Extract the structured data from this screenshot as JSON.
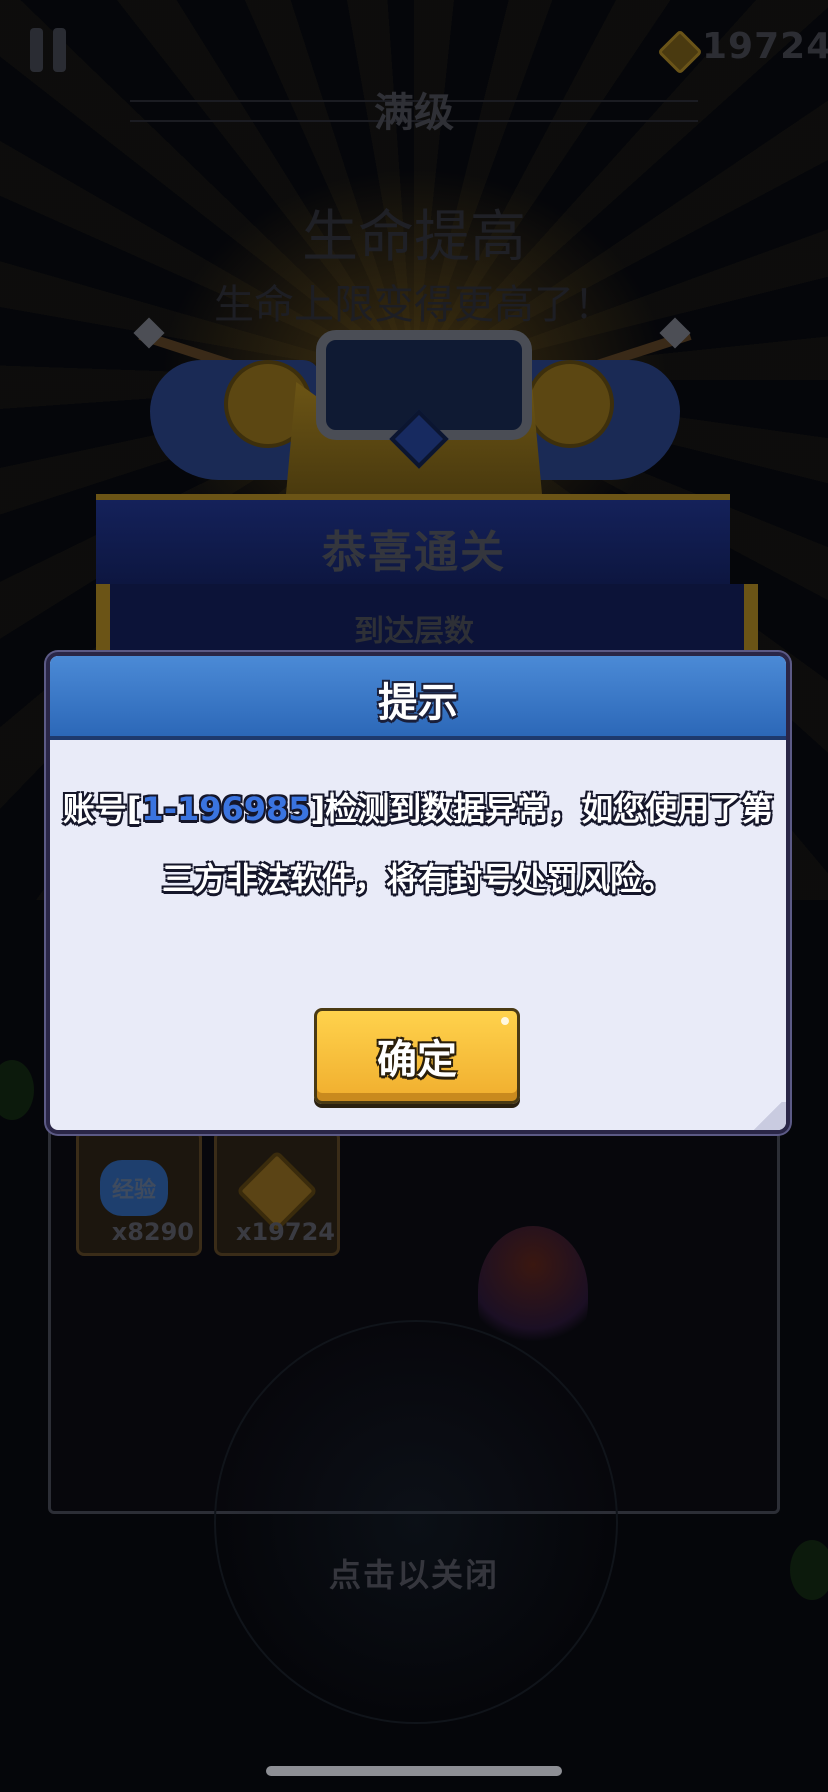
{
  "hud": {
    "gold_count": "19724",
    "pause_icon": "pause-icon",
    "gem_icon": "diamond-gem-icon"
  },
  "background": {
    "max_level": "满级",
    "bonus_title": "生命提高",
    "bonus_desc": "生命上限变得更高了！",
    "victory_title": "恭喜通关",
    "floor_reached_label": "到达层数",
    "rewards": [
      {
        "badge": "经验",
        "count": "x8290",
        "icon": "exp-badge-icon"
      },
      {
        "count": "x19724",
        "icon": "bow-arrow-icon"
      }
    ],
    "tap_to_close": "点击以关闭"
  },
  "dialog": {
    "title": "提示",
    "message_prefix": "账号[",
    "account_id": "1-196985",
    "message_suffix": "]检测到数据异常，如您使用了第",
    "message_line2": "三方非法软件，将有封号处罚风险。",
    "confirm_label": "确定"
  },
  "colors": {
    "dialog_header": "#2c68b8",
    "dialog_body": "#e9ebf8",
    "account_id": "#3a74e0",
    "confirm_button": "#f0ae2e"
  }
}
